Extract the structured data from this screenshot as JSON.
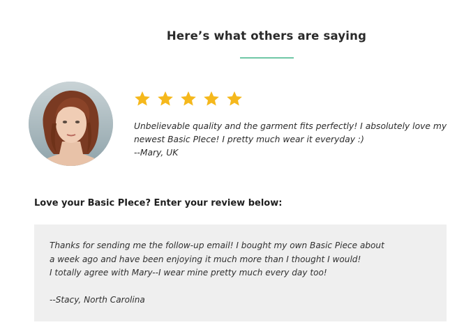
{
  "section": {
    "heading": "Here’s what others are saying",
    "accent_color": "#6fc7a6"
  },
  "testimonial": {
    "rating": 5,
    "max_rating": 5,
    "star_color": "#f5b81c",
    "avatar_icon": "user-photo",
    "quote_lines": [
      "Unbelievable quality and the garment fits perfectly! I absolutely love my",
      "newest Basic PIece!  I pretty much wear it everyday :)"
    ],
    "author": "--Mary, UK"
  },
  "form": {
    "label": "Love your Basic PIece? Enter your review below:",
    "value_lines": [
      "Thanks for sending me the follow-up email! I bought my own Basic Piece about",
      "a week ago and have been enjoying it much more than I thought I would!",
      "I totally agree with Mary--I wear mine pretty much every day too!",
      "",
      "--Stacy, North Carolina"
    ],
    "box_color": "#efefef"
  }
}
